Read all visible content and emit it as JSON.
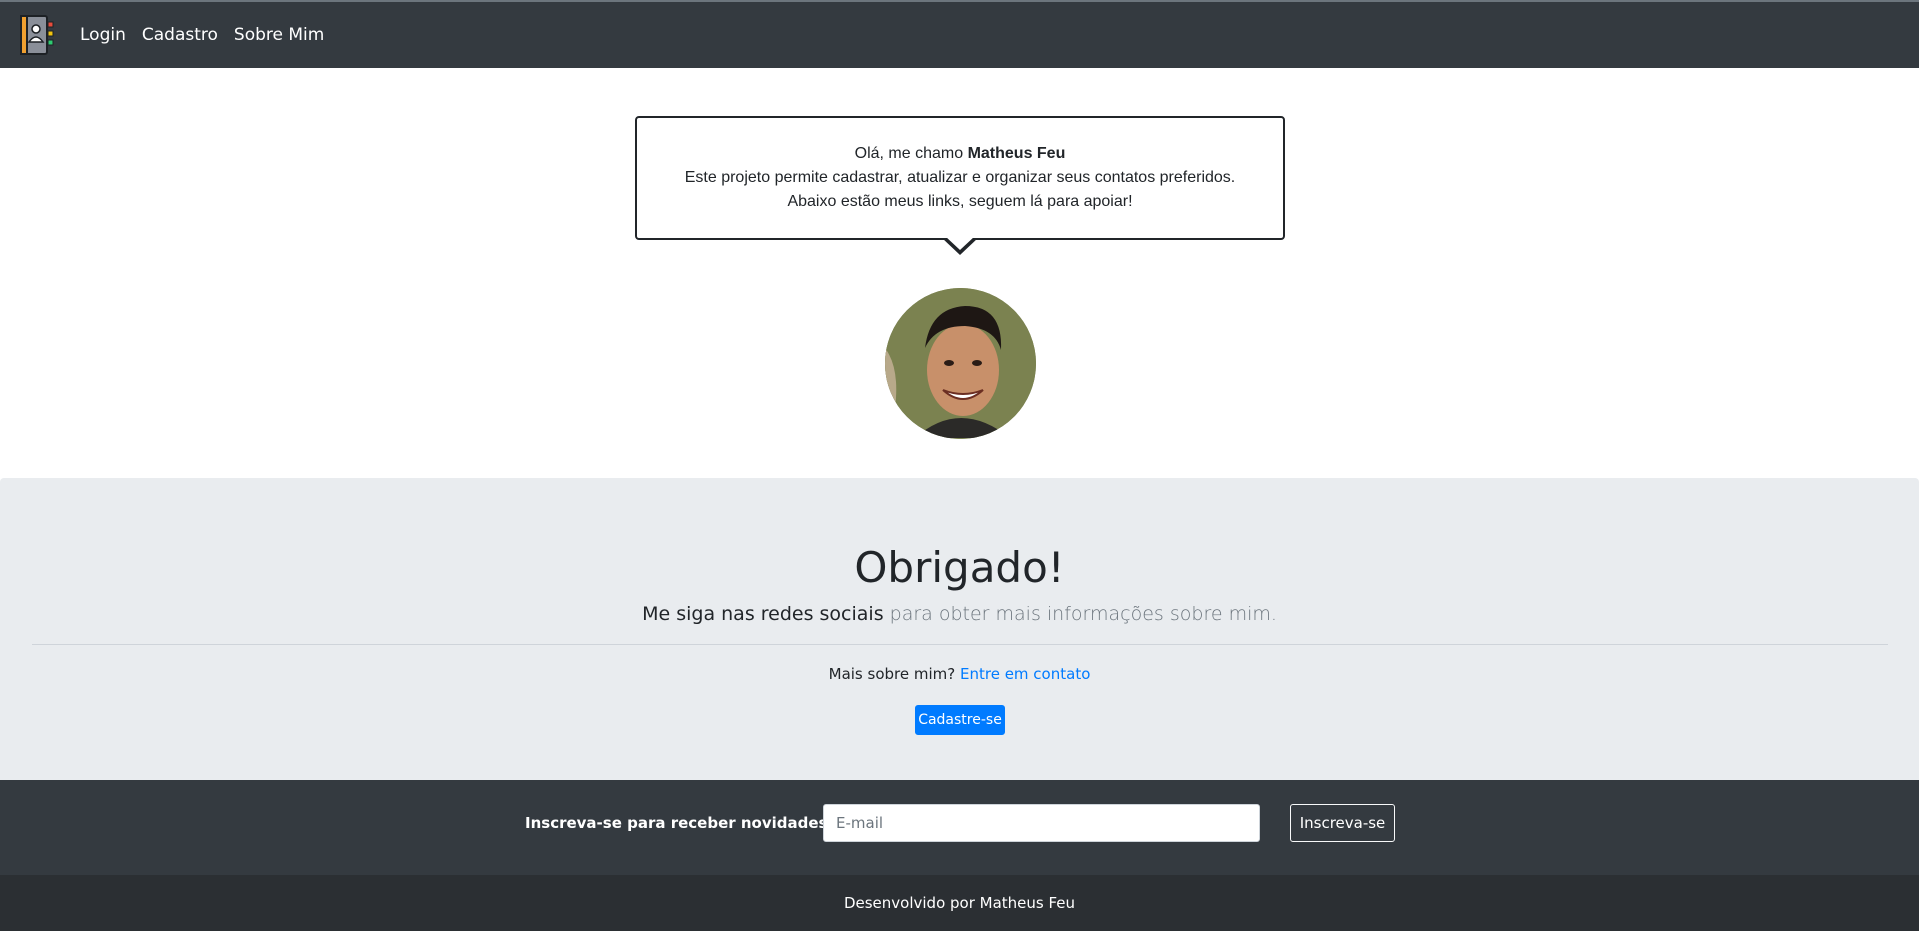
{
  "navbar": {
    "brand_icon": "contact-book-icon",
    "links": [
      "Login",
      "Cadastro",
      "Sobre Mim"
    ]
  },
  "bubble": {
    "greeting_prefix": "Olá, me chamo",
    "name": "Matheus Feu",
    "line2": "Este projeto permite cadastrar, atualizar e organizar seus contatos preferidos.",
    "line3": "Abaixo estão meus links, seguem lá para apoiar!"
  },
  "jumbotron": {
    "title": "Obrigado!",
    "lead_strong": "Me siga nas redes sociais",
    "lead_rest": "para obter mais informações sobre mim.",
    "more_text": "Mais sobre mim?",
    "more_link": "Entre em contato",
    "button": "Cadastre-se"
  },
  "newsletter": {
    "label": "Inscreva-se para receber novidades:",
    "input_placeholder": "E-mail",
    "button": "Inscreva-se"
  },
  "footer": {
    "text": "Desenvolvido por Matheus Feu"
  },
  "colors": {
    "navbar": "#343a40",
    "jumbotron": "#e9ecef",
    "primary": "#007bff",
    "footer": "#2b2f33"
  }
}
